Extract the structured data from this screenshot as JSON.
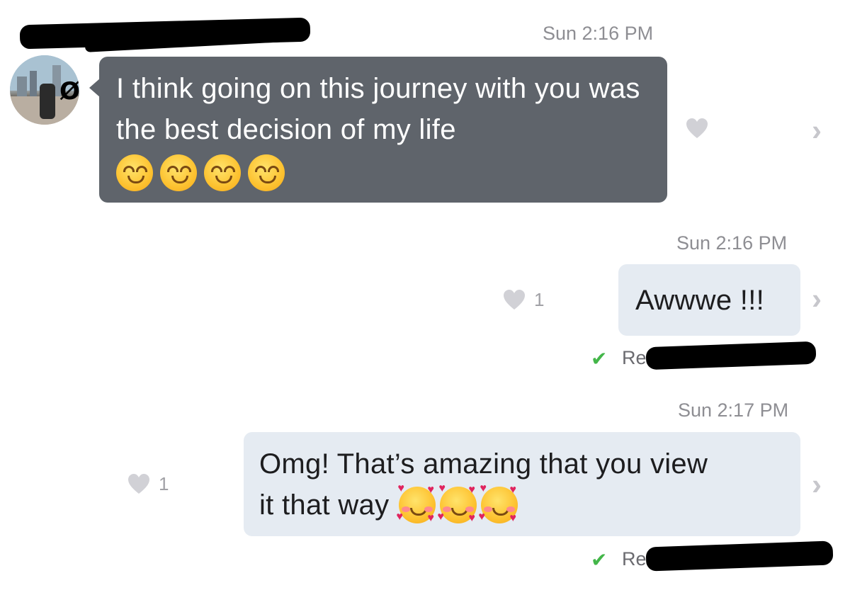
{
  "conversation": {
    "messages": [
      {
        "direction": "incoming",
        "timestamp": "Sun 2:16 PM",
        "text": "I think going on this journey with you was the best decision of my life",
        "emoji": [
          "relieved-face",
          "relieved-face",
          "relieved-face",
          "relieved-face"
        ]
      },
      {
        "direction": "outgoing",
        "timestamp": "Sun 2:16 PM",
        "text": "Awwwe !!!",
        "likes": "1",
        "status": "Re"
      },
      {
        "direction": "outgoing",
        "timestamp": "Sun 2:17 PM",
        "text_line1": "Omg! That’s amazing that you view",
        "text_line2": "it that way",
        "emoji": [
          "smiling-face-with-hearts",
          "smiling-face-with-hearts",
          "smiling-face-with-hearts"
        ],
        "likes": "1",
        "status": "Re"
      }
    ]
  },
  "icons": {
    "like": "heart-icon",
    "disclosure": "chevron-right-icon",
    "read_receipt": "checkmark-icon"
  },
  "colors": {
    "incoming_bubble": "#5f646b",
    "outgoing_bubble": "#e5ebf2",
    "read_check": "#43b649",
    "timestamp": "#8e8e93"
  }
}
